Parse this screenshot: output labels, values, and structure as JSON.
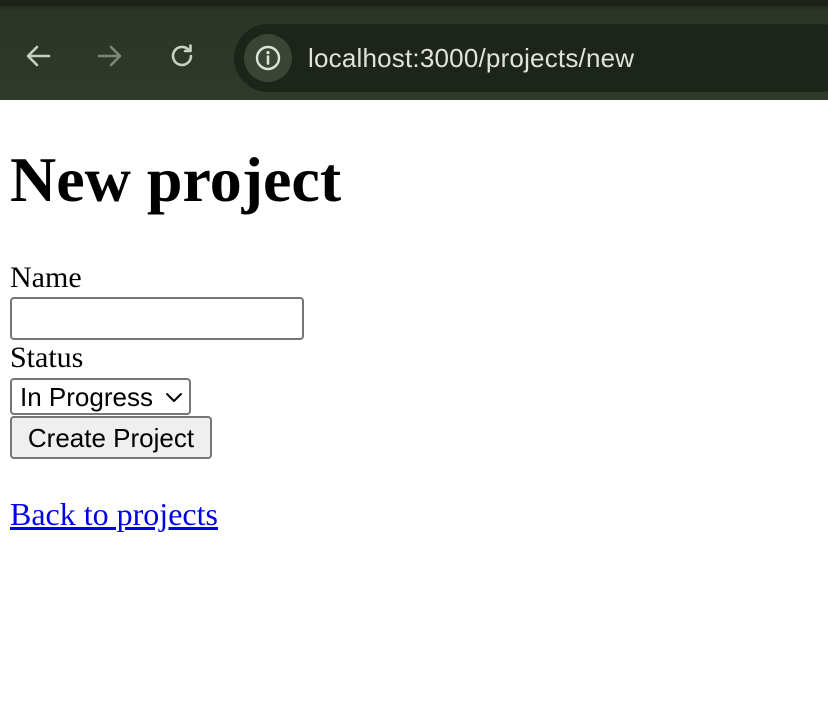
{
  "browser": {
    "url": "localhost:3000/projects/new",
    "icons": {
      "back": "arrow-left-icon",
      "forward": "arrow-right-icon",
      "reload": "reload-icon",
      "site_info": "info-circle-icon"
    },
    "forward_enabled": false
  },
  "page": {
    "title": "New project",
    "form": {
      "name_label": "Name",
      "name_value": "",
      "status_label": "Status",
      "status_selected": "In Progress",
      "submit_label": "Create Project"
    },
    "back_link": "Back to projects"
  },
  "colors": {
    "toolbar": "#2f3a2a",
    "omnibox": "#1d2419",
    "link": "#0000ee"
  }
}
